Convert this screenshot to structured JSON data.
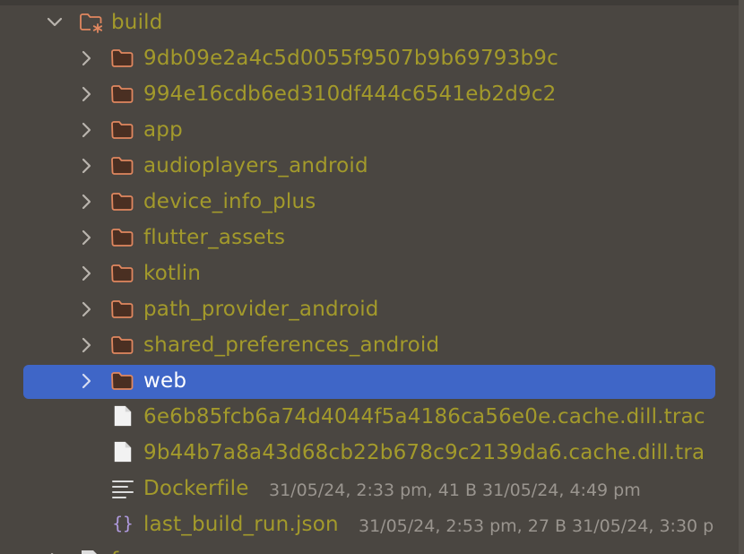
{
  "tree": {
    "root": {
      "label": "build"
    },
    "children": [
      {
        "label": "9db09e2a4c5d0055f9507b9b69793b9c",
        "type": "folder"
      },
      {
        "label": "994e16cdb6ed310df444c6541eb2d9c2",
        "type": "folder"
      },
      {
        "label": "app",
        "type": "folder"
      },
      {
        "label": "audioplayers_android",
        "type": "folder"
      },
      {
        "label": "device_info_plus",
        "type": "folder"
      },
      {
        "label": "flutter_assets",
        "type": "folder"
      },
      {
        "label": "kotlin",
        "type": "folder"
      },
      {
        "label": "path_provider_android",
        "type": "folder"
      },
      {
        "label": "shared_preferences_android",
        "type": "folder"
      },
      {
        "label": "web",
        "type": "folder",
        "selected": true
      },
      {
        "label": "6e6b85fcb6a74d4044f5a4186ca56e0e.cache.dill.trac",
        "type": "file"
      },
      {
        "label": "9b44b7a8a43d68cb22b678c9c2139da6.cache.dill.tra",
        "type": "file"
      },
      {
        "label": "Dockerfile",
        "type": "text-file",
        "meta": "31/05/24, 2:33 pm, 41 B 31/05/24, 4:49 pm"
      },
      {
        "label": "last_build_run.json",
        "type": "json-file",
        "meta": "31/05/24, 2:53 pm, 27 B 31/05/24, 3:30 p"
      }
    ],
    "next_item_label": "f"
  },
  "colors": {
    "background": "#4a4641",
    "selection": "#3f66c7",
    "label": "#a39a2b",
    "selected_label": "#ffffff",
    "meta": "#9a958f",
    "folder_fill": "#4a2f22",
    "folder_stroke": "#e0875f",
    "chevron": "#b9b4ad"
  },
  "icons": {
    "expanded": "chevron-down-icon",
    "collapsed": "chevron-right-icon",
    "folder": "folder-icon",
    "build_folder": "excluded-folder-icon",
    "file": "file-icon",
    "text_file": "text-file-icon",
    "json_file": "json-file-icon"
  }
}
